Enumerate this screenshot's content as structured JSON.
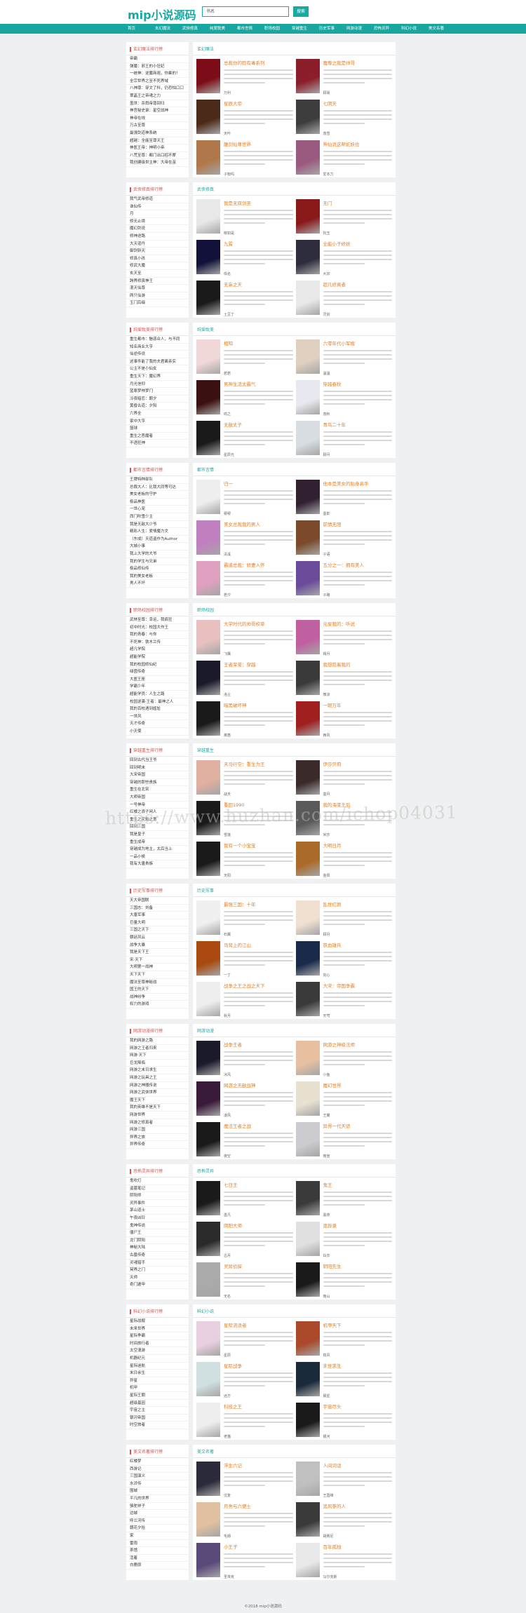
{
  "header": {
    "logo": "mip小说源码",
    "search_value": "书名",
    "search_btn": "搜索"
  },
  "nav": [
    "首页",
    "玄幻魔法",
    "武侠修真",
    "纯爱耽美",
    "都市言情",
    "职场校园",
    "穿越重生",
    "历史军事",
    "网游动漫",
    "恐怖灵异",
    "科幻小说",
    "美文名著"
  ],
  "watermark": "https://www.huzhan.com/ichop04031",
  "footer": "©2018 mip小说源码",
  "sections": [
    {
      "rank": "玄幻魔法排行榜",
      "cat": "玄幻魔法",
      "list": [
        "帝霸",
        "弹魔：邪王的小狂妃",
        "一统神：逆魔商祖，你乘的！",
        "全宗世界之至不死界域",
        "八神尊：穿文了科，仍恐怕口口",
        "翠晶王之帝魂之力",
        "盖世：杀戮帝尊回归",
        "神宫秘史录：星空战神",
        "神帝在线",
        "万古至尊",
        "最强剑道神系统",
        "超越：全能至尊天王",
        "神医王帝：神明小帝",
        "八荒至尊：都门出口招不摩",
        "我创建级世主神：大帝在苗"
      ],
      "books": [
        {
          "t": "总裁你的脸有毒系列",
          "a": "万利",
          "c": "#7c0c18"
        },
        {
          "t": "魔尊之我是帅哥",
          "a": "顾易",
          "c": "#8b1e2a"
        },
        {
          "t": "星辰大帝",
          "a": "天叶",
          "c": "#4b2a1a"
        },
        {
          "t": "七阴天",
          "a": "落雪",
          "c": "#3d3d3d"
        },
        {
          "t": "腹剑仙尊世界",
          "a": "子衡吗",
          "c": "#b0784a"
        },
        {
          "t": "神仙说这帮蛇妖也",
          "a": "爱本力",
          "c": "#9a5a80"
        }
      ]
    },
    {
      "rank": "武侠修真排行榜",
      "cat": "武侠修真",
      "list": [
        "我气武帝修道",
        "诛仙传",
        "月",
        "修无止境",
        "魔幻剑说",
        "修神途路",
        "大天道丹",
        "御剑斩天",
        "修真小孩",
        "修武大魔",
        "玄天至",
        "跨界修真神王",
        "混天仙尊",
        "两只仙游",
        "玉门后缀"
      ],
      "books": [
        {
          "t": "我是无双剑圣",
          "a": "柳如是",
          "c": "#e8e8e8"
        },
        {
          "t": "无门",
          "a": "阮玉",
          "c": "#8a1a1a"
        },
        {
          "t": "九霄",
          "a": "佚名",
          "c": "#11113a"
        },
        {
          "t": "全能小子修妖",
          "a": "大宗",
          "c": "#2d2d3d"
        },
        {
          "t": "无妄之天",
          "a": "土豆丁",
          "c": "#1a1a1a"
        },
        {
          "t": "超凡修真者",
          "a": "灵剑",
          "c": "#e8e8e8"
        }
      ]
    },
    {
      "rank": "纯爱耽美排行榜",
      "cat": "纯爱耽美",
      "list": [
        "重生都市：魅惑众人，与不同",
        "知名商业大亨",
        "仙逆传说",
        "这事件能了我的夫君离亲实",
        "公主不是小仙女",
        "重生天下：魔幻界",
        "月光信仰",
        "蓝寒梦林梦门",
        "冷夜暗恋：朝夕",
        "黄昏古道：夕阳",
        "六界全",
        "家中大亨",
        "篮球",
        "重生之恶魔者",
        "不语狂神"
      ],
      "books": [
        {
          "t": "相知",
          "a": "若若",
          "c": "#f0d8d8"
        },
        {
          "t": "六零年代小军嫂",
          "a": "温温",
          "c": "#e0d0c0"
        },
        {
          "t": "男神生活太霸气",
          "a": "鸣之",
          "c": "#3a1010"
        },
        {
          "t": "穿越春秋",
          "a": "落秋",
          "c": "#e8e8f0"
        },
        {
          "t": "无敌太子",
          "a": "星辰光",
          "c": "#1a1a1a"
        },
        {
          "t": "青鸟二十年",
          "a": "顾月",
          "c": "#d8dde2"
        }
      ]
    },
    {
      "rank": "都市言情排行榜",
      "cat": "都市言情",
      "list": [
        "王牌特种部队",
        "总裁大人：比我大同等可达",
        "美女老板的守护",
        "极品神医",
        "一世心宠",
        "西门吹雪少主",
        "我是无敌大少爷",
        "精彩人生：爱情魔力文",
        "（东成）天道盗作为Author",
        "大城小事",
        "我上大学的大爷",
        "我的学生与兄弟",
        "极品修仙传",
        "我的美女老板",
        "男人不坏"
      ],
      "books": [
        {
          "t": "归一",
          "a": "穆穆",
          "c": "#eeeeee"
        },
        {
          "t": "他本是美女的贴身高手",
          "a": "墨影",
          "c": "#302030"
        },
        {
          "t": "美女总裁我的男人",
          "a": "清溪",
          "c": "#c080c0"
        },
        {
          "t": "前情无限",
          "a": "子语",
          "c": "#7a4a2a"
        },
        {
          "t": "霸道总裁：娇妻入怀",
          "a": "若汐",
          "c": "#e0a0c0"
        },
        {
          "t": "五分之一：拥有美人",
          "a": "子路",
          "c": "#6a4a9a"
        }
      ]
    },
    {
      "rank": "职场校园排行榜",
      "cat": "职场校园",
      "list": [
        "武林至尊：幸运，我疯狂",
        "初中时光：校园大作王",
        "我的青春：与你",
        "不死神：铁木兰传",
        "超凡学院",
        "超能学院",
        "我的校园修仙纪",
        "绿茵传奇",
        "大医王座",
        "学霸少年",
        "超能学员：人生之路",
        "校园逆袭·王者：最神之人",
        "我的百校遇到尴尬",
        "一世风",
        "天才传奇",
        "小天使"
      ],
      "books": [
        {
          "t": "大学时代的帅哥校草",
          "a": "飞鹰",
          "c": "#e8c0c0"
        },
        {
          "t": "元星我的：听说",
          "a": "晴月",
          "c": "#c060a0"
        },
        {
          "t": "王者荣誉：穿越",
          "a": "洛尘",
          "c": "#1a1a2a"
        },
        {
          "t": "我想陪着我的",
          "a": "微凉",
          "c": "#3a3a3a"
        },
        {
          "t": "暗黑破坏神",
          "a": "离笛",
          "c": "#1a1a1a"
        },
        {
          "t": "一眼万年",
          "a": "西风",
          "c": "#a02020"
        }
      ]
    },
    {
      "rank": "穿越重生排行榜",
      "cat": "穿越重生",
      "list": [
        "回到古代当王爷",
        "回到明末",
        "大宋帝国",
        "穿越的那些贵族",
        "重生在北宋",
        "大明帝国",
        "一号神帝",
        "红楼之浪子闲人",
        "重生之花魁之意",
        "回到三国",
        "我是皇子",
        "重生成帝",
        "穿越成为地主，太后当上",
        "一品小侯",
        "我有大唐贵族"
      ],
      "books": [
        {
          "t": "天马行空：重生为王",
          "a": "战天",
          "c": "#e0b0a0"
        },
        {
          "t": "伊莎贝莉",
          "a": "墨月",
          "c": "#3a2a2a"
        },
        {
          "t": "重回1990",
          "a": "雪莲",
          "c": "#1a1a1a"
        },
        {
          "t": "我的海棠王后",
          "a": "米莎",
          "c": "#5a5a5a"
        },
        {
          "t": "我有一个小宝宝",
          "a": "天阳",
          "c": "#1a1a1a"
        },
        {
          "t": "大明日月",
          "a": "金阳",
          "c": "#aa6a2a"
        }
      ]
    },
    {
      "rank": "历史军事排行榜",
      "cat": "历史军事",
      "list": [
        "天大帝国联",
        "三国志：刘备",
        "大唐军事",
        "巨量大明",
        "三国之天下",
        "朝廷风云",
        "战争大暴",
        "我是天下王",
        "宋·天下",
        "大明第一战神",
        "天下天下",
        "魔法至尊神秘战",
        "国王的天下",
        "战神纷争",
        "权力的游戏"
      ],
      "books": [
        {
          "t": "最强三国：十年",
          "a": "石翼",
          "c": "#f0f0f0"
        },
        {
          "t": "乱世红颜",
          "a": "顾月",
          "c": "#f0e0d0"
        },
        {
          "t": "马背上的江山",
          "a": "一丁",
          "c": "#aa4a10"
        },
        {
          "t": "铁血雄兵",
          "a": "剑心",
          "c": "#1a2a4a"
        },
        {
          "t": "战争之王之战之天下",
          "a": "秋月",
          "c": "#eeeeee"
        },
        {
          "t": "大宋：帝国争霸",
          "a": "天穹",
          "c": "#3a3a3a"
        }
      ]
    },
    {
      "rank": "网游动漫排行榜",
      "cat": "网游动漫",
      "list": [
        "我的网游之路",
        "网游之王者归来",
        "网游·天下",
        "巨龙降临",
        "网游之末日求生",
        "网游之玩具之王",
        "网游之神器传说",
        "网游之武侠世界",
        "魔王天下",
        "我的英雄不是天下",
        "网游世界",
        "网游之修真者",
        "网游三国",
        "异界之旅",
        "异界传奇"
      ],
      "books": [
        {
          "t": "战争王者",
          "a": "冰风",
          "c": "#1a1a2a"
        },
        {
          "t": "网游之神级法师",
          "a": "小鱼",
          "c": "#e8c0a0"
        },
        {
          "t": "网游之无敌战神",
          "a": "凌风",
          "c": "#3a1a3a"
        },
        {
          "t": "魔幻世界",
          "a": "王翼",
          "c": "#e8e0d0"
        },
        {
          "t": "魔法王者之战",
          "a": "夜空",
          "c": "#1a1a1a"
        },
        {
          "t": "异界一代天骄",
          "a": "南宫",
          "c": "#ccccd0"
        }
      ]
    },
    {
      "rank": "恐怖灵异排行榜",
      "cat": "恐怖灵异",
      "list": [
        "鬼吹灯",
        "盗墓笔记",
        "阴阳师",
        "灵异事件",
        "茅山道士",
        "午夜凶铃",
        "鬼神传说",
        "僵尸王",
        "龙门阴阳",
        "神秘大陆",
        "古墓传奇",
        "灵魂猎手",
        "冥界之门",
        "天师",
        "奇门遁甲"
      ],
      "books": [
        {
          "t": "七日王",
          "a": "墨凡",
          "c": "#1a1a1a"
        },
        {
          "t": "鬼王",
          "a": "黑夜",
          "c": "#3a3a3a"
        },
        {
          "t": "阴阳大师",
          "a": "古月",
          "c": "#2a2a2a"
        },
        {
          "t": "诡异录",
          "a": "白衣",
          "c": "#e0e0e0"
        },
        {
          "t": "灵异侦探",
          "a": "无名",
          "c": "#aaaaaa"
        },
        {
          "t": "阴阳先生",
          "a": "南山",
          "c": "#1a1a1a"
        }
      ]
    },
    {
      "rank": "科幻小说排行榜",
      "cat": "科幻小说",
      "list": [
        "星际战舰",
        "未来世界",
        "星际争霸",
        "时间旅行者",
        "太空漫游",
        "机器纪元",
        "星际迷航",
        "末日余生",
        "异星",
        "机甲",
        "星际王朝",
        "超级基因",
        "宇宙之主",
        "银河帝国",
        "时空旅者"
      ],
      "books": [
        {
          "t": "星际流浪者",
          "a": "星辰",
          "c": "#e8d0e0"
        },
        {
          "t": "机甲天下",
          "a": "铁风",
          "c": "#aa4a2a"
        },
        {
          "t": "星际战争",
          "a": "远方",
          "c": "#d0e0e0"
        },
        {
          "t": "末世求生",
          "a": "晨星",
          "c": "#1a2a3a"
        },
        {
          "t": "科技之王",
          "a": "老猫",
          "c": "#eeeeee"
        },
        {
          "t": "宇宙尽头",
          "a": "银河",
          "c": "#1a1a1a"
        }
      ]
    },
    {
      "rank": "美文名著排行榜",
      "cat": "美文名著",
      "list": [
        "红楼梦",
        "西游记",
        "三国演义",
        "水浒传",
        "围城",
        "平凡的世界",
        "骆驼祥子",
        "边城",
        "呼兰河传",
        "朝花夕拾",
        "家",
        "雷雨",
        "茶馆",
        "活着",
        "白鹿原"
      ],
      "books": [
        {
          "t": "浮生六记",
          "a": "沈复",
          "c": "#2a2a3a"
        },
        {
          "t": "人间词话",
          "a": "王国维",
          "c": "#c0c0c0"
        },
        {
          "t": "月亮与六便士",
          "a": "毛姆",
          "c": "#e0c0a0"
        },
        {
          "t": "追风筝的人",
          "a": "胡赛尼",
          "c": "#3a3a3a"
        },
        {
          "t": "小王子",
          "a": "圣埃克",
          "c": "#5a4a7a"
        },
        {
          "t": "百年孤独",
          "a": "马尔克斯",
          "c": "#e8e8e8"
        }
      ]
    }
  ]
}
